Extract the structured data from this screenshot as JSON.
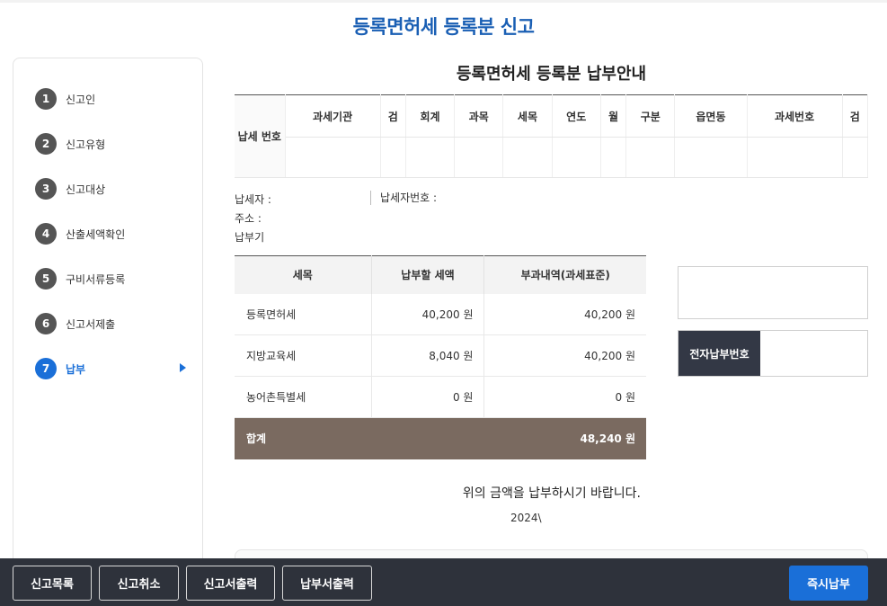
{
  "page_title": "등록면허세 등록분 신고",
  "steps": [
    {
      "num": "1",
      "label": "신고인"
    },
    {
      "num": "2",
      "label": "신고유형"
    },
    {
      "num": "3",
      "label": "신고대상"
    },
    {
      "num": "4",
      "label": "산출세액확인"
    },
    {
      "num": "5",
      "label": "구비서류등록"
    },
    {
      "num": "6",
      "label": "신고서제출"
    },
    {
      "num": "7",
      "label": "납부",
      "active": true
    }
  ],
  "notice_title": "등록면허세 등록분 납부안내",
  "tax_number": {
    "row_header": "납세 번호",
    "columns": [
      "과세기관",
      "검",
      "회계",
      "과목",
      "세목",
      "연도",
      "월",
      "구분",
      "읍면동",
      "과세번호",
      "검"
    ]
  },
  "payer": {
    "taxpayer_label": "납세자 :",
    "address_label": "주소 :",
    "due_label": "납부기",
    "taxpayer_no_label": "납세자번호 :"
  },
  "amounts": {
    "headers": [
      "세목",
      "납부할 세액",
      "부과내역(과세표준)"
    ],
    "rows": [
      {
        "name": "등록면허세",
        "amount": "40,200 원",
        "base": "40,200 원"
      },
      {
        "name": "지방교육세",
        "amount": "8,040 원",
        "base": "40,200 원"
      },
      {
        "name": "농어촌특별세",
        "amount": "0 원",
        "base": "0 원"
      }
    ],
    "total_label": "합계",
    "total_amount": "48,240 원"
  },
  "epay_label": "전자납부번호",
  "request_text": "위의 금액을 납부하시기 바랍니다.",
  "year_text": "2024\\",
  "footer": {
    "list": "신고목록",
    "cancel": "신고취소",
    "print_report": "신고서출력",
    "print_payment": "납부서출력",
    "pay_now": "즉시납부"
  },
  "colors": {
    "accent": "#1a6fd8",
    "title": "#1a5fb4",
    "total_row": "#7a6a60",
    "footer": "#2e323b"
  }
}
